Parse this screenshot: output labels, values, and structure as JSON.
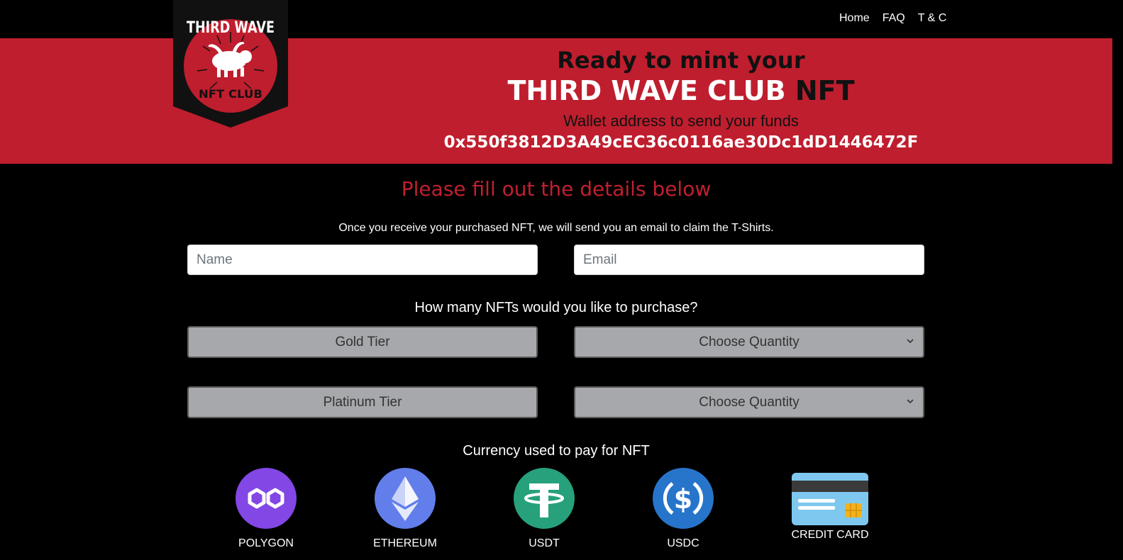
{
  "nav": {
    "links": [
      "Home",
      "FAQ",
      "T & C"
    ]
  },
  "logo": {
    "top_text": "THIRD WAVE",
    "bottom_text": "NFT CLUB"
  },
  "hero": {
    "line1": "Ready to mint your",
    "line2_white": "THIRD WAVE CLUB ",
    "line2_dark": "NFT",
    "line3": "Wallet address to send your funds",
    "wallet_address": "0x550f3812D3A49cEC36c0116ae30Dc1dD1446472F"
  },
  "form": {
    "title": "Please fill out the details below",
    "note": "Once you receive your purchased NFT, we will send you an email to claim the T-Shirts.",
    "name_placeholder": "Name",
    "email_placeholder": "Email",
    "quantity_question": "How many NFTs would you like to purchase?",
    "tiers": [
      {
        "label": "Gold Tier",
        "select": "Choose Quantity"
      },
      {
        "label": "Platinum Tier",
        "select": "Choose Quantity"
      }
    ],
    "currency_title": "Currency used to pay for NFT",
    "currencies": [
      "POLYGON",
      "ETHEREUM",
      "USDT",
      "USDC",
      "CREDIT CARD"
    ]
  },
  "colors": {
    "brand_red": "#bf1e2e",
    "polygon": "#8247e5",
    "ethereum": "#627eea",
    "usdt": "#26a17b",
    "usdc": "#2775ca"
  }
}
